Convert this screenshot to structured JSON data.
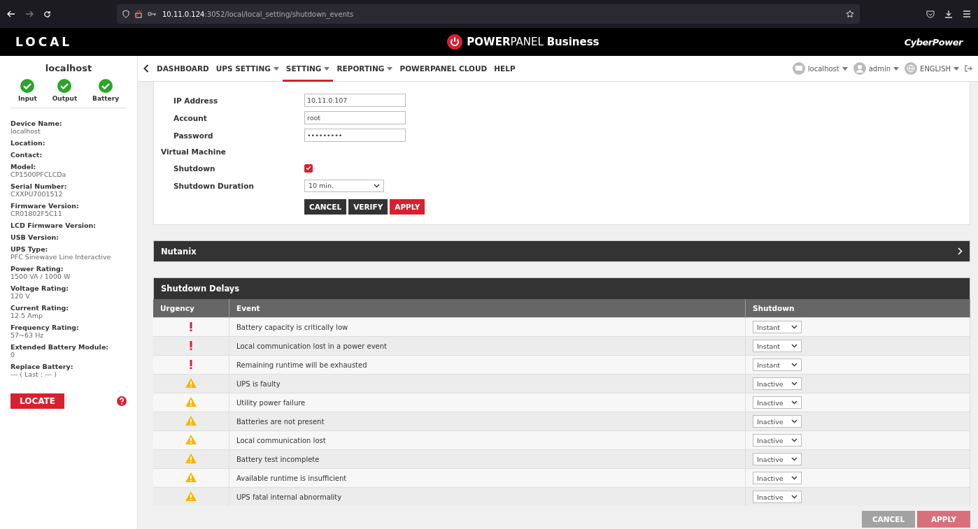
{
  "browser": {
    "url_host": "10.11.0.124",
    "url_path": ":3052/local/local_setting/shutdown_events"
  },
  "header": {
    "left_title": "LOCAL",
    "product_bold": "POWER",
    "product_light": "PANEL",
    "product_suffix": "Business",
    "brand": "CyberPower"
  },
  "sidebar": {
    "host": "localhost",
    "status": [
      {
        "label": "Input",
        "ok": true
      },
      {
        "label": "Output",
        "ok": true
      },
      {
        "label": "Battery",
        "ok": true
      }
    ],
    "fields": [
      {
        "label": "Device Name:",
        "value": "localhost"
      },
      {
        "label": "Location:"
      },
      {
        "label": "Contact:"
      },
      {
        "label": "Model:",
        "value": "CP1500PFCLCDa"
      },
      {
        "label": "Serial Number:",
        "value": "CXXPU7001512"
      },
      {
        "label": "Firmware Version:",
        "value": "CR01802F5C11"
      },
      {
        "label": "LCD Firmware Version:"
      },
      {
        "label": "USB Version:"
      },
      {
        "label": "UPS Type:",
        "value": "PFC Sinewave Line Interactive"
      },
      {
        "label": "Power Rating:",
        "value": "1500 VA / 1000 W"
      },
      {
        "label": "Voltage Rating:",
        "value": "120 V"
      },
      {
        "label": "Current Rating:",
        "value": "12.5 Amp"
      },
      {
        "label": "Frequency Rating:",
        "value": "57~63 Hz"
      },
      {
        "label": "Extended Battery Module:",
        "value": "0"
      },
      {
        "label": "Replace Battery:",
        "value": "--- ( Last : --- )"
      }
    ],
    "locate_button": "LOCATE"
  },
  "nav": {
    "items": [
      {
        "label": "DASHBOARD",
        "has_menu": false,
        "selected": false
      },
      {
        "label": "UPS SETTING",
        "has_menu": true,
        "selected": false
      },
      {
        "label": "SETTING",
        "has_menu": true,
        "selected": true
      },
      {
        "label": "REPORTING",
        "has_menu": true,
        "selected": false
      },
      {
        "label": "POWERPANEL CLOUD",
        "has_menu": false,
        "selected": false
      },
      {
        "label": "HELP",
        "has_menu": false,
        "selected": false
      }
    ],
    "right": [
      {
        "kind": "host",
        "label": "localhost"
      },
      {
        "kind": "user",
        "label": "admin"
      },
      {
        "kind": "language",
        "label": "ENGLISH"
      }
    ]
  },
  "form": {
    "fields": [
      {
        "label": "IP Address",
        "value": "10.11.0.107"
      },
      {
        "label": "Account",
        "value": "root"
      },
      {
        "label": "Password",
        "value": "•••••••••"
      }
    ],
    "section": "Virtual Machine",
    "shutdown_label": "Shutdown",
    "shutdown_checked": true,
    "duration_label": "Shutdown Duration",
    "duration_value": "10 min.",
    "buttons": [
      {
        "label": "CANCEL",
        "kind": "dark"
      },
      {
        "label": "VERIFY",
        "kind": "dark"
      },
      {
        "label": "APPLY",
        "kind": "primary"
      }
    ]
  },
  "nutanix": {
    "title": "Nutanix",
    "expanded": false
  },
  "delays": {
    "title": "Shutdown Delays",
    "columns": [
      "Urgency",
      "Event",
      "Shutdown"
    ],
    "rows": [
      {
        "kind": "critical",
        "event": "Battery capacity is critically low",
        "shutdown": "Instant"
      },
      {
        "kind": "critical",
        "event": "Local communication lost in a power event",
        "shutdown": "Instant"
      },
      {
        "kind": "critical",
        "event": "Remaining runtime will be exhausted",
        "shutdown": "Instant"
      },
      {
        "kind": "warning",
        "event": "UPS is faulty",
        "shutdown": "Inactive"
      },
      {
        "kind": "warning",
        "event": "Utility power failure",
        "shutdown": "Inactive"
      },
      {
        "kind": "warning",
        "event": "Batteries are not present",
        "shutdown": "Inactive"
      },
      {
        "kind": "warning",
        "event": "Local communication lost",
        "shutdown": "Inactive"
      },
      {
        "kind": "warning",
        "event": "Battery test incomplete",
        "shutdown": "Inactive"
      },
      {
        "kind": "warning",
        "event": "Available runtime is insufficient",
        "shutdown": "Inactive"
      },
      {
        "kind": "warning",
        "event": "UPS fatal internal abnormality",
        "shutdown": "Inactive"
      }
    ],
    "buttons": [
      {
        "label": "CANCEL",
        "kind": "grey",
        "disabled": true
      },
      {
        "label": "APPLY",
        "kind": "primary",
        "disabled": true
      }
    ]
  }
}
